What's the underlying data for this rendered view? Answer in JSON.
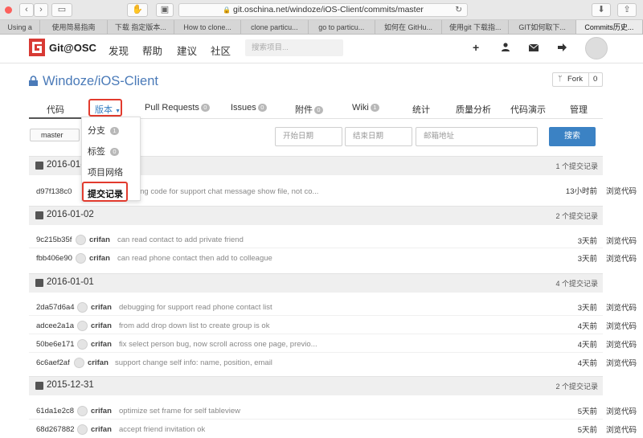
{
  "browser": {
    "url": "git.oschina.net/windoze/iOS-Client/commits/master",
    "tabs": [
      "Using a",
      "使用简易指南",
      "下载 指定版本...",
      "How to clone...",
      "clone particu...",
      "go to particu...",
      "如何在 GitHu...",
      "使用git 下载指...",
      "GIT如何取下...",
      "Commits历史..."
    ],
    "active_tab_index": 9
  },
  "header": {
    "logo": "Git@OSC",
    "nav": [
      "发现",
      "帮助",
      "建议",
      "社区"
    ],
    "search_placeholder": "搜索项目...",
    "icons": [
      "plus-icon",
      "user-icon",
      "mail-icon",
      "signout-icon"
    ]
  },
  "project": {
    "title": "Windoze/iOS-Client",
    "fork_label": "Fork",
    "fork_count": "0"
  },
  "repo_tabs": [
    {
      "label": "代码",
      "badge": ""
    },
    {
      "label": "版本",
      "badge": ""
    },
    {
      "label": "Pull Requests",
      "badge": "0"
    },
    {
      "label": "Issues",
      "badge": "0"
    },
    {
      "label": "附件",
      "badge": "0"
    },
    {
      "label": "Wiki",
      "badge": "1"
    },
    {
      "label": "统计",
      "badge": ""
    },
    {
      "label": "质量分析",
      "badge": ""
    },
    {
      "label": "代码演示",
      "badge": ""
    },
    {
      "label": "管理",
      "badge": ""
    }
  ],
  "dropdown": {
    "items": [
      {
        "label": "分支",
        "badge": "1"
      },
      {
        "label": "标签",
        "badge": "0"
      },
      {
        "label": "项目网络",
        "badge": ""
      },
      {
        "label": "提交记录",
        "badge": ""
      }
    ]
  },
  "filters": {
    "branch": "master",
    "start_placeholder": "开始日期",
    "end_placeholder": "结束日期",
    "email_placeholder": "邮箱地址",
    "search_button": "搜索"
  },
  "groups": [
    {
      "date": "2016-01-",
      "count": "1 个提交记录",
      "commits": [
        {
          "sha": "d97f138c0",
          "author": "",
          "message": "ing code for support chat message show file, not co...",
          "time": "13小时前",
          "browse": "浏览代码"
        }
      ]
    },
    {
      "date": "2016-01-02",
      "count": "2 个提交记录",
      "commits": [
        {
          "sha": "9c215b35f",
          "author": "crifan",
          "message": "can read contact to add private friend",
          "time": "3天前",
          "browse": "浏览代码"
        },
        {
          "sha": "fbb406e90",
          "author": "crifan",
          "message": "can read phone contact then add to colleague",
          "time": "3天前",
          "browse": "浏览代码"
        }
      ]
    },
    {
      "date": "2016-01-01",
      "count": "4 个提交记录",
      "commits": [
        {
          "sha": "2da57d6a4",
          "author": "crifan",
          "message": "debugging for support read phone contact list",
          "time": "3天前",
          "browse": "浏览代码"
        },
        {
          "sha": "adcee2a1a",
          "author": "crifan",
          "message": "from add drop down list to create group is ok",
          "time": "4天前",
          "browse": "浏览代码"
        },
        {
          "sha": "50be6e171",
          "author": "crifan",
          "message": "fix select person bug, now scroll across one page, previo...",
          "time": "4天前",
          "browse": "浏览代码"
        },
        {
          "sha": "6c6aef2af",
          "author": "crifan",
          "message": "support change self info: name, position, email",
          "time": "4天前",
          "browse": "浏览代码"
        }
      ]
    },
    {
      "date": "2015-12-31",
      "count": "2 个提交记录",
      "commits": [
        {
          "sha": "61da1e2c8",
          "author": "crifan",
          "message": "optimize set frame for self tableview",
          "time": "5天前",
          "browse": "浏览代码"
        },
        {
          "sha": "68d267882",
          "author": "crifan",
          "message": "accept friend invitation ok",
          "time": "5天前",
          "browse": "浏览代码"
        }
      ]
    }
  ],
  "colors": {
    "accent": "#3b82c4",
    "brand": "#d83a34",
    "highlight": "#e23b2e"
  }
}
